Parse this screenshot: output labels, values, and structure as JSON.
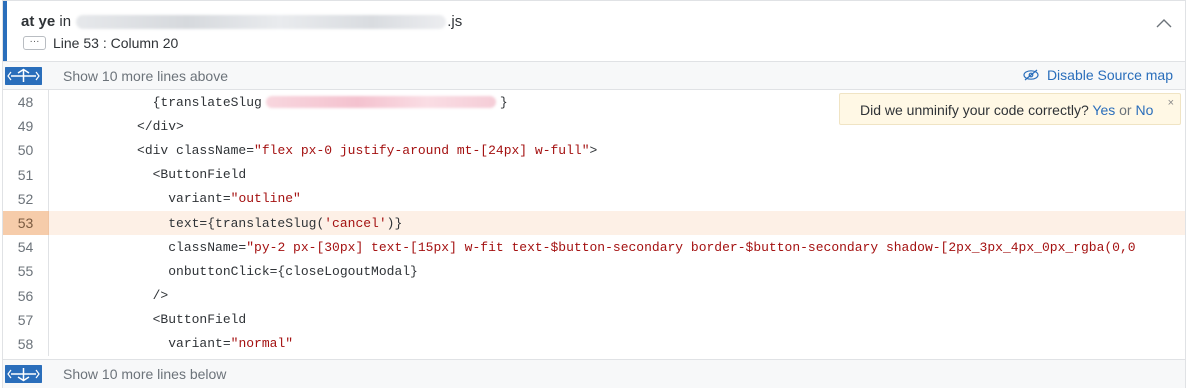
{
  "frame": {
    "function": "at ye",
    "in_word": "in",
    "file_ext": ".js",
    "location": "Line 53 : Column 20",
    "ellipsis": "···"
  },
  "expand": {
    "above": "Show 10 more lines above",
    "below": "Show 10 more lines below"
  },
  "sourcemap": {
    "disable_label": "Disable Source map"
  },
  "notice": {
    "question": "Did we unminify your code correctly?",
    "yes": "Yes",
    "or": "or",
    "no": "No",
    "close": "×"
  },
  "code": {
    "active_line": 53,
    "lines": [
      {
        "n": "48",
        "pre": "            {translateSlug",
        "rest": "}"
      },
      {
        "n": "49",
        "text": "          </div>"
      },
      {
        "n": "50",
        "pre": "          <div className=",
        "str": "\"flex px-0 justify-around mt-[24px] w-full\"",
        "post": ">"
      },
      {
        "n": "51",
        "text": "            <ButtonField"
      },
      {
        "n": "52",
        "pre": "              variant=",
        "str": "\"outline\"",
        "post": ""
      },
      {
        "n": "53",
        "pre": "              text={translateSlug(",
        "str": "'cancel'",
        "post": ")}"
      },
      {
        "n": "54",
        "pre": "              className=",
        "str": "\"py-2 px-[30px] text-[15px] w-fit text-$button-secondary border-$button-secondary shadow-[2px_3px_4px_0px_rgba(0,0",
        "post": ""
      },
      {
        "n": "55",
        "text": "              onbuttonClick={closeLogoutModal}"
      },
      {
        "n": "56",
        "text": "            />"
      },
      {
        "n": "57",
        "text": "            <ButtonField"
      },
      {
        "n": "58",
        "pre": "              variant=",
        "str": "\"normal\"",
        "post": ""
      }
    ]
  },
  "colors": {
    "accent": "#2a6ebb",
    "active_line_bg": "#fdf0e6",
    "active_gutter_bg": "#f6ccaa",
    "string": "#a41111",
    "notice_bg": "#fff8e5"
  },
  "icons": [
    "chevron-up-icon",
    "expand-up-icon",
    "expand-down-icon",
    "eye-slash-icon",
    "close-icon"
  ]
}
